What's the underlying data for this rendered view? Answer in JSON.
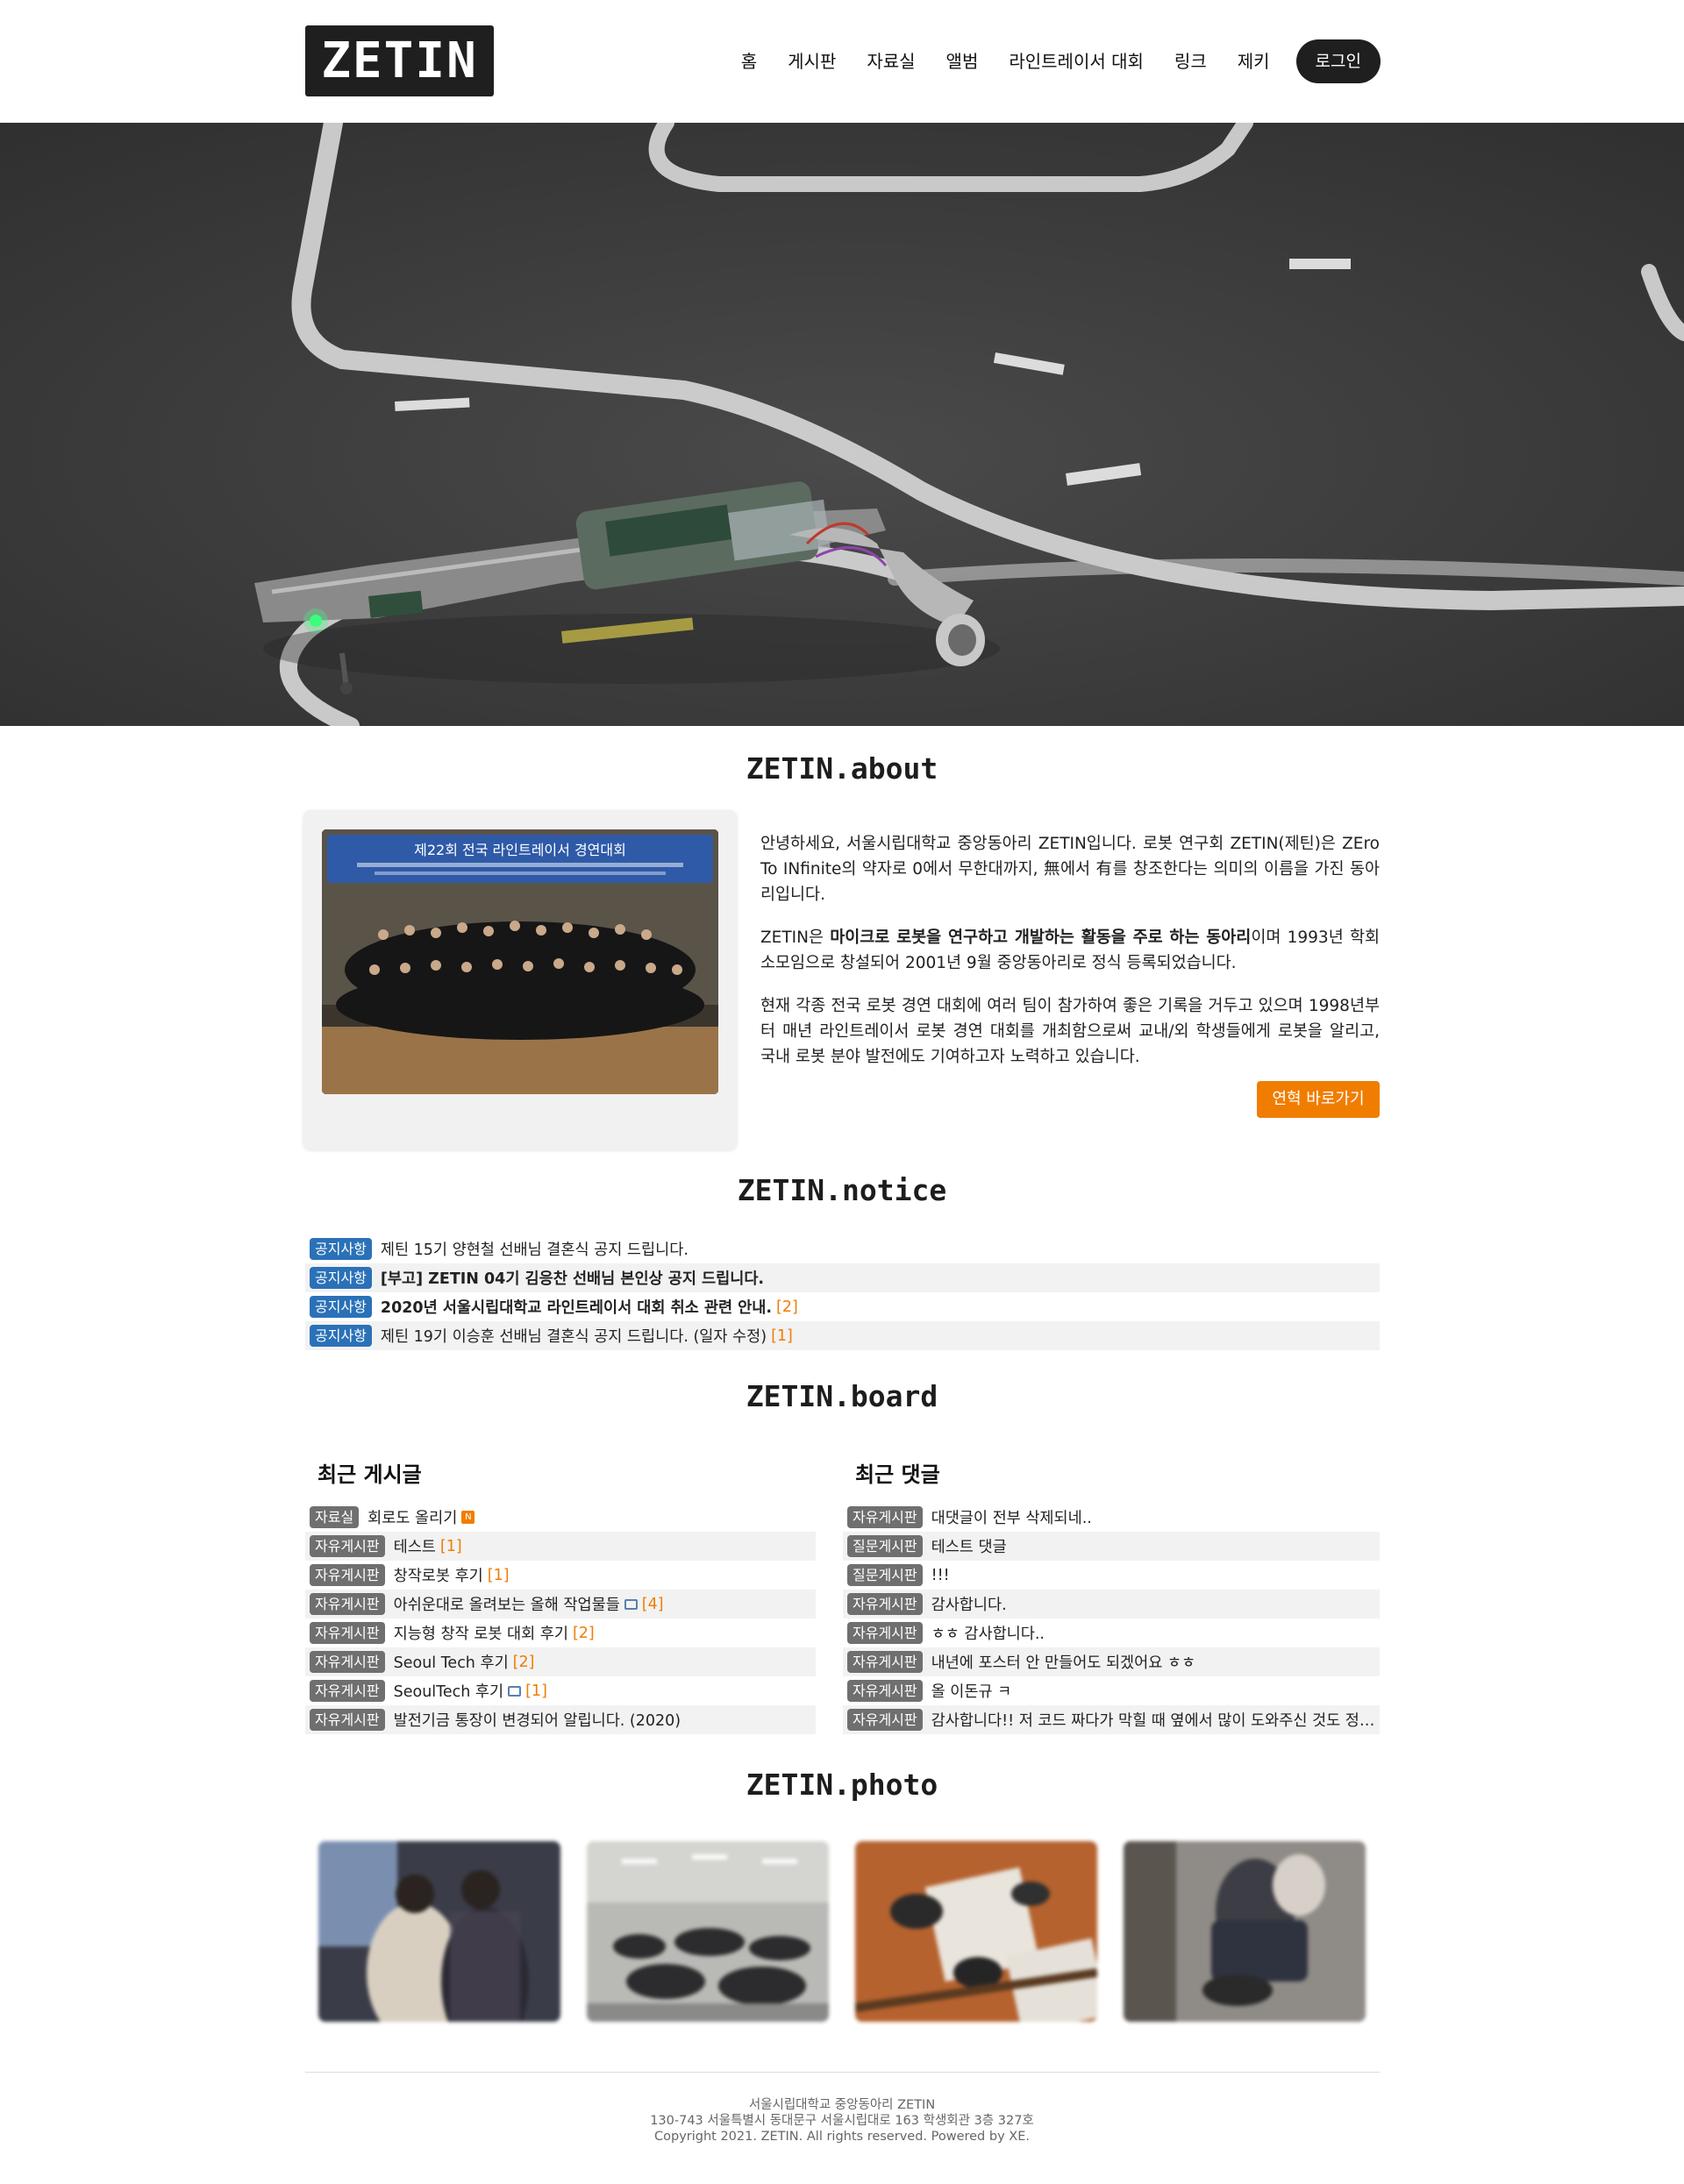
{
  "header": {
    "logo": "ZETIN",
    "nav": [
      "홈",
      "게시판",
      "자료실",
      "앨범",
      "라인트레이서 대회",
      "링크",
      "제키"
    ],
    "login": "로그인"
  },
  "about": {
    "title": "ZETIN.about",
    "photo_banner": "제22회 전국 라인트레이서 경연대회",
    "p1": "안녕하세요, 서울시립대학교 중앙동아리 ZETIN입니다. 로봇 연구회 ZETIN(제틴)은 ZEro To INfinite의 약자로 0에서 무한대까지, 無에서 有를 창조한다는 의미의 이름을 가진 동아리입니다.",
    "p2_pre": "ZETIN은 ",
    "p2_bold": "마이크로 로봇을 연구하고 개발하는 활동을 주로 하는 동아리",
    "p2_post": "이며 1993년 학회 소모임으로 창설되어 2001년 9월 중앙동아리로 정식 등록되었습니다.",
    "p3": "현재 각종 전국 로봇 경연 대회에 여러 팀이 참가하여 좋은 기록을 거두고 있으며 1998년부터 매년 라인트레이서 로봇 경연 대회를 개최함으로써 교내/외 학생들에게 로봇을 알리고, 국내 로봇 분야 발전에도 기여하고자 노력하고 있습니다.",
    "button": "연혁 바로가기"
  },
  "notice": {
    "title": "ZETIN.notice",
    "items": [
      {
        "badge": "공지사항",
        "text": "제틴 15기 양현철 선배님 결혼식 공지 드립니다.",
        "count": ""
      },
      {
        "badge": "공지사항",
        "text": "[부고] ZETIN 04기 김응찬 선배님 본인상 공지 드립니다.",
        "count": ""
      },
      {
        "badge": "공지사항",
        "text": "2020년 서울시립대학교 라인트레이서 대회 취소 관련 안내.",
        "count": "[2]"
      },
      {
        "badge": "공지사항",
        "text": "제틴 19기 이승훈 선배님 결혼식 공지 드립니다. (일자 수정)",
        "count": "[1]"
      }
    ]
  },
  "board": {
    "title": "ZETIN.board",
    "recent_posts_title": "최근 게시글",
    "recent_comments_title": "최근 댓글",
    "posts": [
      {
        "badge": "자료실",
        "text": "회로도 올리기",
        "count": ""
      },
      {
        "badge": "자유게시판",
        "text": "테스트",
        "count": "[1]"
      },
      {
        "badge": "자유게시판",
        "text": "창작로봇 후기",
        "count": "[1]"
      },
      {
        "badge": "자유게시판",
        "text": "아쉬운대로 올려보는 올해 작업물들",
        "count": "[4]"
      },
      {
        "badge": "자유게시판",
        "text": "지능형 창작 로봇 대회 후기",
        "count": "[2]"
      },
      {
        "badge": "자유게시판",
        "text": "Seoul Tech 후기",
        "count": "[2]"
      },
      {
        "badge": "자유게시판",
        "text": "SeoulTech 후기",
        "count": "[1]"
      },
      {
        "badge": "자유게시판",
        "text": "발전기금 통장이 변경되어 알립니다. (2020)",
        "count": ""
      }
    ],
    "comments": [
      {
        "badge": "자유게시판",
        "text": "대댓글이 전부 삭제되네.."
      },
      {
        "badge": "질문게시판",
        "text": "테스트 댓글"
      },
      {
        "badge": "질문게시판",
        "text": "!!!"
      },
      {
        "badge": "자유게시판",
        "text": "감사합니다."
      },
      {
        "badge": "자유게시판",
        "text": "ㅎㅎ 감사합니다.."
      },
      {
        "badge": "자유게시판",
        "text": "내년에 포스터 안 만들어도 되겠어요 ㅎㅎ"
      },
      {
        "badge": "자유게시판",
        "text": "올 이돈규 ㅋ"
      },
      {
        "badge": "자유게시판",
        "text": "감사합니다!! 저 코드 짜다가 막힐 때 옆에서 많이 도와주신 것도 정말..."
      }
    ]
  },
  "photo": {
    "title": "ZETIN.photo"
  },
  "footer": {
    "line1": "서울시립대학교 중앙동아리 ZETIN",
    "line2": "130-743 서울특별시 동대문구 서울시립대로 163 학생회관 3층 327호",
    "line3": "Copyright 2021. ZETIN. All rights reserved. Powered by XE."
  }
}
